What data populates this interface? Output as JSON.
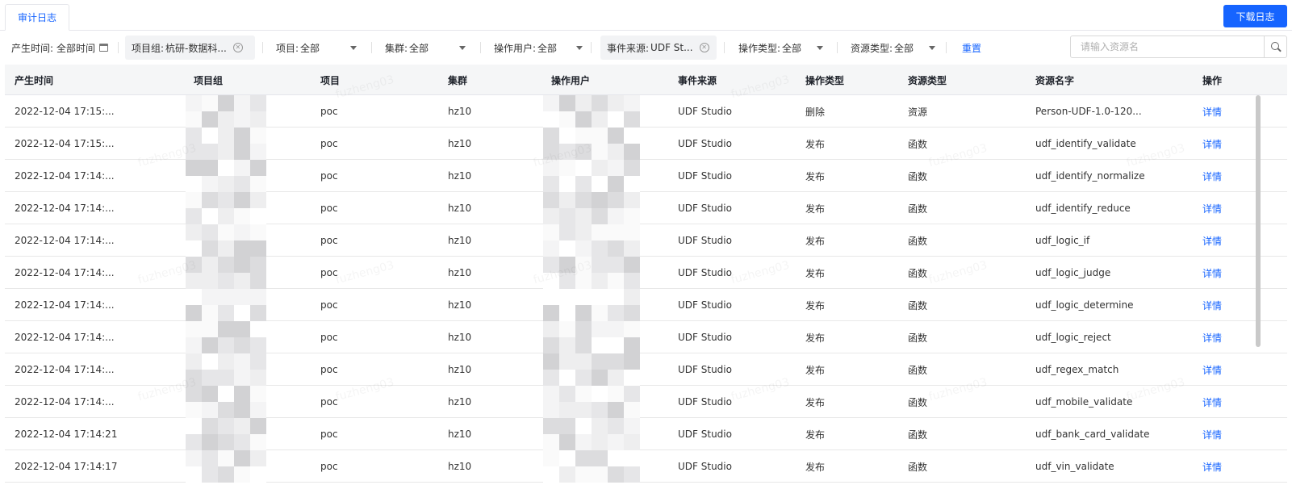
{
  "tabs": [
    {
      "label": "审计日志",
      "active": true
    }
  ],
  "download_label": "下载日志",
  "filters": {
    "time": {
      "label": "产生时间:",
      "value": "全部时间"
    },
    "project_group": {
      "label": "项目组:",
      "value": "杭研-数据科..."
    },
    "project": {
      "label": "项目:",
      "value": "全部"
    },
    "cluster": {
      "label": "集群:",
      "value": "全部"
    },
    "op_user": {
      "label": "操作用户:",
      "value": "全部"
    },
    "event_source": {
      "label": "事件来源:",
      "value": "UDF St..."
    },
    "op_type": {
      "label": "操作类型:",
      "value": "全部"
    },
    "resource_type": {
      "label": "资源类型:",
      "value": "全部"
    },
    "reset_label": "重置"
  },
  "search": {
    "placeholder": "请输入资源名"
  },
  "columns": [
    "产生时间",
    "项目组",
    "项目",
    "集群",
    "操作用户",
    "事件来源",
    "操作类型",
    "资源类型",
    "资源名字",
    "操作"
  ],
  "rows": [
    {
      "time": "2022-12-04 17:15:...",
      "project": "poc",
      "cluster": "hz10",
      "source": "UDF Studio",
      "op_type": "删除",
      "res_type": "资源",
      "res_name": "Person-UDF-1.0-120...",
      "action": "详情"
    },
    {
      "time": "2022-12-04 17:15:...",
      "project": "poc",
      "cluster": "hz10",
      "source": "UDF Studio",
      "op_type": "发布",
      "res_type": "函数",
      "res_name": "udf_identify_validate",
      "action": "详情"
    },
    {
      "time": "2022-12-04 17:14:...",
      "project": "poc",
      "cluster": "hz10",
      "source": "UDF Studio",
      "op_type": "发布",
      "res_type": "函数",
      "res_name": "udf_identify_normalize",
      "action": "详情"
    },
    {
      "time": "2022-12-04 17:14:...",
      "project": "poc",
      "cluster": "hz10",
      "source": "UDF Studio",
      "op_type": "发布",
      "res_type": "函数",
      "res_name": "udf_identify_reduce",
      "action": "详情"
    },
    {
      "time": "2022-12-04 17:14:...",
      "project": "poc",
      "cluster": "hz10",
      "source": "UDF Studio",
      "op_type": "发布",
      "res_type": "函数",
      "res_name": "udf_logic_if",
      "action": "详情"
    },
    {
      "time": "2022-12-04 17:14:...",
      "project": "poc",
      "cluster": "hz10",
      "source": "UDF Studio",
      "op_type": "发布",
      "res_type": "函数",
      "res_name": "udf_logic_judge",
      "action": "详情"
    },
    {
      "time": "2022-12-04 17:14:...",
      "project": "poc",
      "cluster": "hz10",
      "source": "UDF Studio",
      "op_type": "发布",
      "res_type": "函数",
      "res_name": "udf_logic_determine",
      "action": "详情"
    },
    {
      "time": "2022-12-04 17:14:...",
      "project": "poc",
      "cluster": "hz10",
      "source": "UDF Studio",
      "op_type": "发布",
      "res_type": "函数",
      "res_name": "udf_logic_reject",
      "action": "详情"
    },
    {
      "time": "2022-12-04 17:14:...",
      "project": "poc",
      "cluster": "hz10",
      "source": "UDF Studio",
      "op_type": "发布",
      "res_type": "函数",
      "res_name": "udf_regex_match",
      "action": "详情"
    },
    {
      "time": "2022-12-04 17:14:...",
      "project": "poc",
      "cluster": "hz10",
      "source": "UDF Studio",
      "op_type": "发布",
      "res_type": "函数",
      "res_name": "udf_mobile_validate",
      "action": "详情"
    },
    {
      "time": "2022-12-04 17:14:21",
      "project": "poc",
      "cluster": "hz10",
      "source": "UDF Studio",
      "op_type": "发布",
      "res_type": "函数",
      "res_name": "udf_bank_card_validate",
      "action": "详情"
    },
    {
      "time": "2022-12-04 17:14:17",
      "project": "poc",
      "cluster": "hz10",
      "source": "UDF Studio",
      "op_type": "发布",
      "res_type": "函数",
      "res_name": "udf_vin_validate",
      "action": "详情"
    }
  ],
  "watermark": "fuzheng03",
  "colors": {
    "accent": "#1664ff",
    "header_bg": "#f5f6f7",
    "border": "#e5e6eb"
  }
}
